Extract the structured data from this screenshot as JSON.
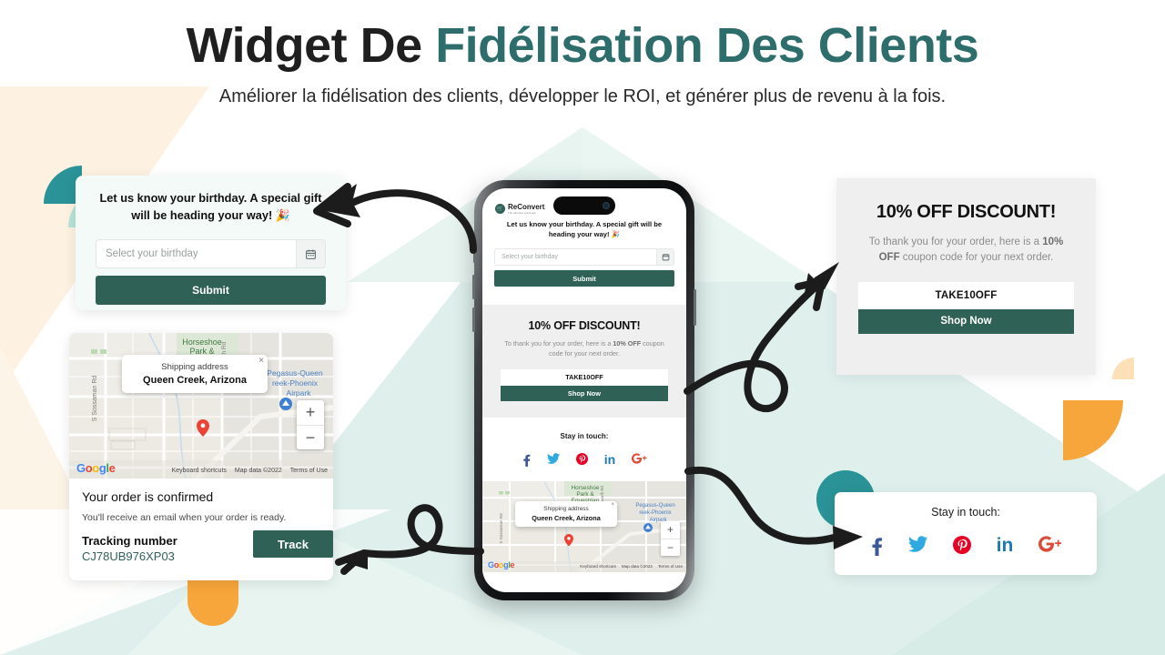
{
  "header": {
    "title_black": "Widget De ",
    "title_accent": "Fidélisation Des Clients",
    "subtitle": "Améliorer la fidélisation des clients, développer le ROI, et générer plus de revenu à la fois."
  },
  "colors": {
    "accent_teal": "#2d6d6b",
    "button_green": "#2f6156",
    "deco_teal": "#2a9397",
    "deco_mint": "#b7e3d8",
    "deco_orange": "#f7a63b",
    "bg_mint": "#dff0ec",
    "bg_cream": "#fdf2e2",
    "facebook": "#3b5998",
    "twitter": "#2eaae1",
    "pinterest": "#e60023",
    "linkedin": "#1c7ab5",
    "googleplus": "#dd4b39"
  },
  "birthday_widget": {
    "message": "Let us know your birthday. A special gift will be heading your way! 🎉",
    "input_placeholder": "Select your birthday",
    "input_value": "",
    "calendar_icon": "calendar-icon",
    "submit_label": "Submit"
  },
  "discount_widget": {
    "title": "10% OFF DISCOUNT!",
    "body_part1": "To thank you for your order, here is a ",
    "body_bold1": "10% OFF",
    "body_part2": " coupon code for your next order.",
    "coupon_code": "TAKE10OFF",
    "cta_label": "Shop Now"
  },
  "social_widget": {
    "title": "Stay in touch:",
    "icons": [
      {
        "name": "facebook-icon",
        "glyph": "f",
        "color": "#3b5998"
      },
      {
        "name": "twitter-icon",
        "glyph": "",
        "color": "#2eaae1"
      },
      {
        "name": "pinterest-icon",
        "glyph": "",
        "color": "#e60023"
      },
      {
        "name": "linkedin-icon",
        "glyph": "in",
        "color": "#1c7ab5"
      },
      {
        "name": "googleplus-icon",
        "glyph": "G+",
        "color": "#dd4b39"
      }
    ]
  },
  "tracking_widget": {
    "map": {
      "popup_label": "Shipping address",
      "popup_value": "Queen Creek, Arizona",
      "close_icon": "×",
      "labels": {
        "park": "Horseshoe Park & Equestrian Centre",
        "road_left": "S Sossaman Rd",
        "road_right": "Ilsworth Rd",
        "airpark": "Pegasus-Queen Creek-Phoenix Airpark"
      },
      "zoom_in": "+",
      "zoom_out": "−",
      "brand": "Google",
      "footer": [
        "Keyboard shortcuts",
        "Map data ©2022",
        "Terms of Use"
      ]
    },
    "heading": "Your order is confirmed",
    "subtext": "You'll receive an email when your order is ready.",
    "tracking_label": "Tracking number",
    "tracking_number": "CJ78UB976XP03",
    "track_button": "Track"
  },
  "phone": {
    "logo_name": "ReConvert",
    "logo_tagline": "The ultimate upsell app",
    "island_name": "dynamic-island"
  }
}
